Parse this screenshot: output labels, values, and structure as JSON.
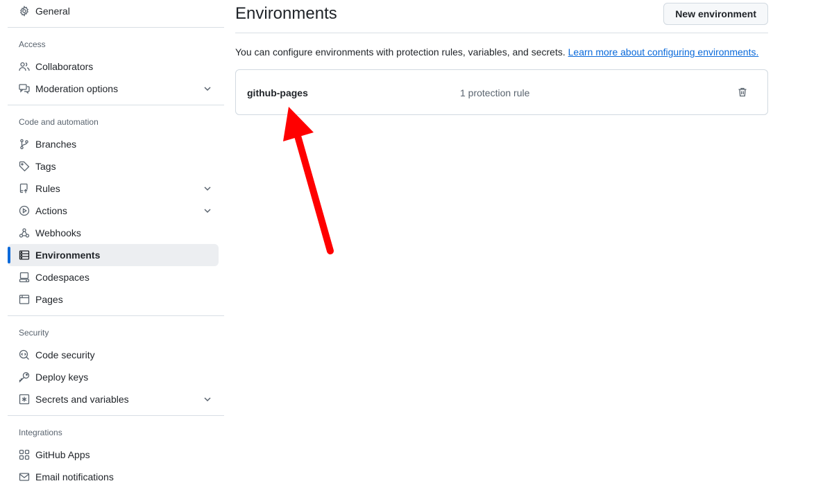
{
  "sidebar": {
    "top_item": {
      "label": "General",
      "icon": "gear-icon"
    },
    "groups": [
      {
        "title": "Access",
        "items": [
          {
            "label": "Collaborators",
            "icon": "people-icon"
          },
          {
            "label": "Moderation options",
            "icon": "comment-discussion-icon",
            "expandable": true
          }
        ]
      },
      {
        "title": "Code and automation",
        "items": [
          {
            "label": "Branches",
            "icon": "git-branch-icon"
          },
          {
            "label": "Tags",
            "icon": "tag-icon"
          },
          {
            "label": "Rules",
            "icon": "repo-push-icon",
            "expandable": true
          },
          {
            "label": "Actions",
            "icon": "play-icon",
            "expandable": true
          },
          {
            "label": "Webhooks",
            "icon": "webhook-icon"
          },
          {
            "label": "Environments",
            "icon": "server-icon",
            "active": true
          },
          {
            "label": "Codespaces",
            "icon": "codespaces-icon"
          },
          {
            "label": "Pages",
            "icon": "browser-icon"
          }
        ]
      },
      {
        "title": "Security",
        "items": [
          {
            "label": "Code security",
            "icon": "codescan-icon"
          },
          {
            "label": "Deploy keys",
            "icon": "key-icon"
          },
          {
            "label": "Secrets and variables",
            "icon": "asterisk-icon",
            "expandable": true
          }
        ]
      },
      {
        "title": "Integrations",
        "items": [
          {
            "label": "GitHub Apps",
            "icon": "apps-icon"
          },
          {
            "label": "Email notifications",
            "icon": "mail-icon"
          }
        ]
      }
    ]
  },
  "main": {
    "title": "Environments",
    "new_button_label": "New environment",
    "description": "You can configure environments with protection rules, variables, and secrets.",
    "learn_more_link": "Learn more about configuring environments.",
    "environments": [
      {
        "name": "github-pages",
        "rules": "1 protection rule"
      }
    ]
  },
  "annotation": {
    "arrow_color": "#ff0000"
  }
}
